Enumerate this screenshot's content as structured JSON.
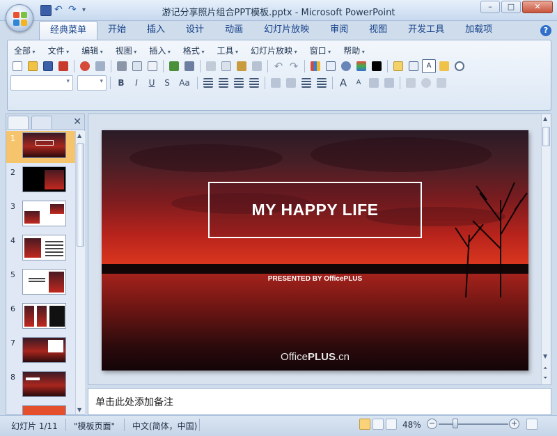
{
  "window": {
    "title": "游记分享照片组合PPT模板.pptx - Microsoft PowerPoint",
    "controls": {
      "minimize": "–",
      "maximize": "□",
      "close": "✕"
    }
  },
  "quick_access": [
    "save-icon",
    "undo-icon",
    "redo-icon",
    "customize-icon"
  ],
  "ribbon_tabs": [
    "经典菜单",
    "开始",
    "插入",
    "设计",
    "动画",
    "幻灯片放映",
    "审阅",
    "视图",
    "开发工具",
    "加载项"
  ],
  "active_tab": "经典菜单",
  "classic_menu": [
    "全部",
    "文件",
    "编辑",
    "视图",
    "插入",
    "格式",
    "工具",
    "幻灯片放映",
    "窗口",
    "帮助"
  ],
  "format_buttons": {
    "bold": "B",
    "italic": "I",
    "underline": "U",
    "shadow": "S",
    "case": "Aa",
    "grow": "A",
    "shrink": "A"
  },
  "font_box": {
    "letter": "A"
  },
  "help": "?",
  "thumbnails": {
    "numbers": [
      "1",
      "2",
      "3",
      "4",
      "5",
      "6",
      "7",
      "8"
    ],
    "selected": 1
  },
  "slide": {
    "title": "MY HAPPY LIFE",
    "presented_by": "PRESENTED BY OfficePLUS",
    "brand_prefix": "Office",
    "brand_bold": "PLUS",
    "brand_suffix": ".cn"
  },
  "notes": {
    "placeholder": "单击此处添加备注"
  },
  "status": {
    "slide_info": "幻灯片 1/11",
    "theme": "\"模板页面\"",
    "language": "中文(简体，中国)",
    "zoom": "48%",
    "zoom_out": "−",
    "zoom_in": "+"
  },
  "colors": {
    "ribbon_text": "#15428b",
    "selected_thumb": "#f6c46c",
    "close_button": "#c8543c"
  }
}
